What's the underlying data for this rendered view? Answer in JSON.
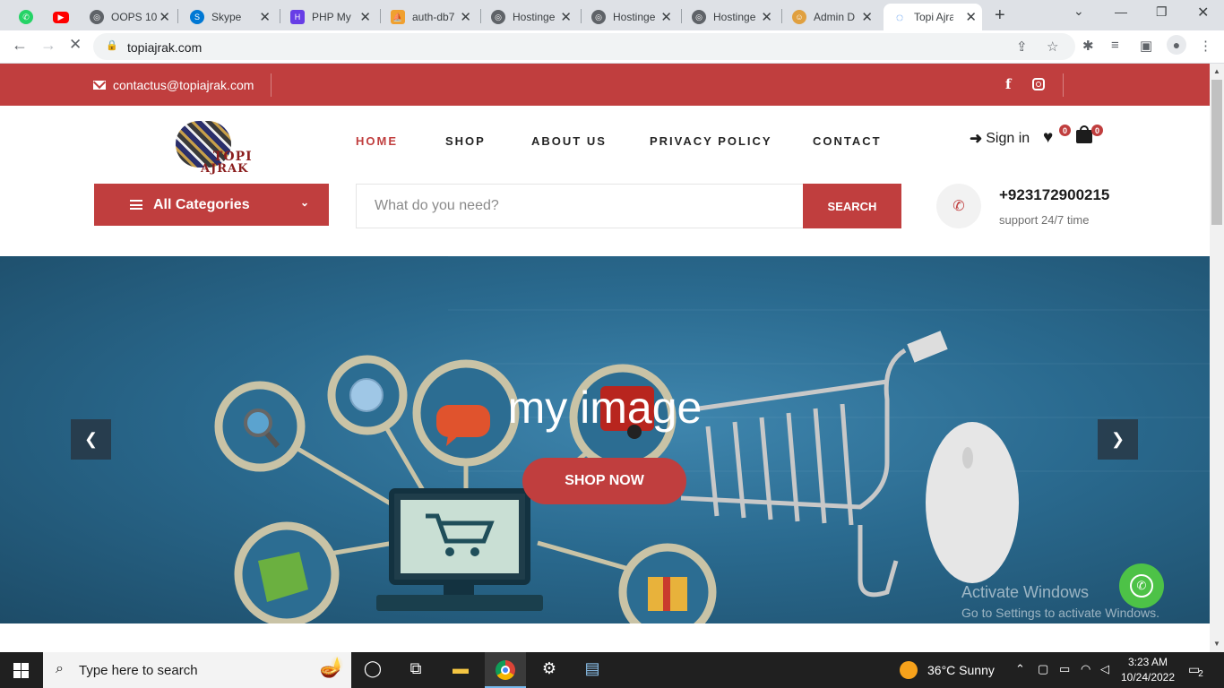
{
  "browser": {
    "tabs": [
      {
        "title": "",
        "icon": "whatsapp-icon",
        "color": "#25d366"
      },
      {
        "title": "",
        "icon": "youtube-icon",
        "color": "#ff0000"
      },
      {
        "title": "OOPS 10",
        "icon": "globe-icon",
        "color": "#5f6368"
      },
      {
        "title": "Skype",
        "icon": "skype-icon",
        "color": "#0078d4"
      },
      {
        "title": "PHP My",
        "icon": "hostinger-icon",
        "color": "#673de6"
      },
      {
        "title": "auth-db7",
        "icon": "phpmyadmin-icon",
        "color": "#f0a030"
      },
      {
        "title": "Hostinge",
        "icon": "globe-icon",
        "color": "#5f6368"
      },
      {
        "title": "Hostinge",
        "icon": "globe-icon",
        "color": "#5f6368"
      },
      {
        "title": "Hostinge",
        "icon": "globe-icon",
        "color": "#5f6368"
      },
      {
        "title": "Admin D",
        "icon": "admin-icon",
        "color": "#e0a040"
      },
      {
        "title": "Topi Ajra",
        "icon": "loading-icon",
        "color": "#1a73e8"
      }
    ],
    "url": "topiajrak.com"
  },
  "site": {
    "contact_email": "contactus@topiajrak.com",
    "logo": {
      "line1": "TOPI",
      "line2": "AJRAK"
    },
    "nav": [
      "HOME",
      "SHOP",
      "ABOUT US",
      "PRIVACY POLICY",
      "CONTACT"
    ],
    "signin": "Sign in",
    "wishlist_count": "0",
    "cart_count": "0",
    "categories_label": "All Categories",
    "search_placeholder": "What do you need?",
    "search_button": "SEARCH",
    "phone": "+923172900215",
    "support": "support 24/7 time",
    "hero_title": "my image",
    "hero_button": "SHOP NOW",
    "watermark_title": "Activate Windows",
    "watermark_sub": "Go to Settings to activate Windows.",
    "accent": "#c03e3e"
  },
  "taskbar": {
    "search_placeholder": "Type here to search",
    "weather": "36°C  Sunny",
    "time": "3:23 AM",
    "date": "10/24/2022",
    "notifications": "2"
  }
}
